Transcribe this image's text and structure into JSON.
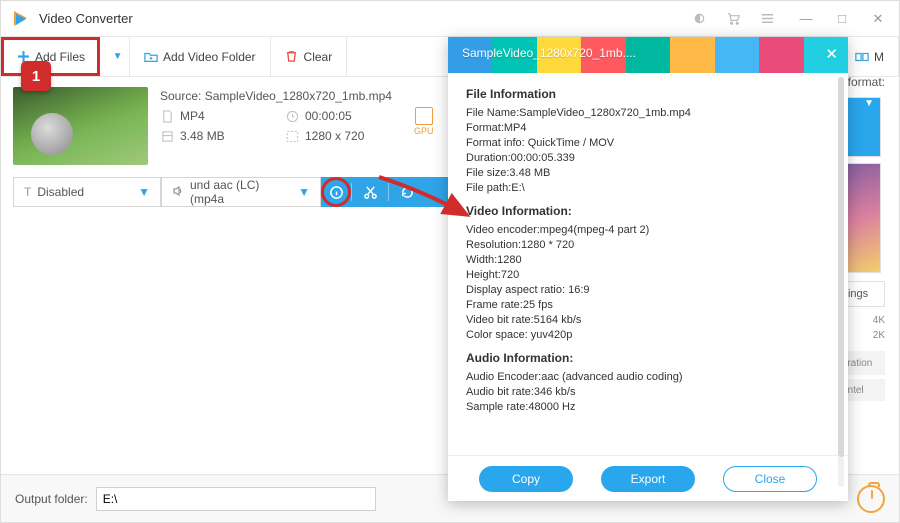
{
  "app": {
    "title": "Video Converter"
  },
  "toolbar": {
    "addFiles": "Add Files",
    "addFolder": "Add Video Folder",
    "clear": "Clear",
    "merge": "M"
  },
  "file": {
    "source": "Source: SampleVideo_1280x720_1mb.mp4",
    "format": "MP4",
    "duration": "00:00:05",
    "size": "3.48 MB",
    "resolution": "1280 x 720",
    "gpu": "GPU"
  },
  "actions": {
    "disabled": "Disabled",
    "audio": "und aac (LC) (mp4a"
  },
  "annotation": {
    "step": "1"
  },
  "sidebar": {
    "label": "ut format:",
    "settings": "ttings",
    "q4k": "4K",
    "q2k": "2K",
    "accel": "celeration",
    "intel": "Intel"
  },
  "output": {
    "label": "Output folder:",
    "path": "E:\\"
  },
  "popup": {
    "title": "SampleVideo_1280x720_1mb....",
    "sectFile": "File Information",
    "fileName": "File Name:SampleVideo_1280x720_1mb.mp4",
    "format": "Format:MP4",
    "formatInfo": "Format info: QuickTime / MOV",
    "duration": "Duration:00:00:05.339",
    "filesize": "File size:3.48 MB",
    "filepath": "File path:E:\\",
    "sectVideo": "Video Information:",
    "vEncoder": "Video encoder:mpeg4(mpeg-4 part 2)",
    "vRes": "Resolution:1280 * 720",
    "vWidth": "Width:1280",
    "vHeight": "Height:720",
    "vDar": "Display aspect ratio: 16:9",
    "vFps": "Frame rate:25 fps",
    "vBitrate": "Video bit rate:5164 kb/s",
    "vColor": "Color space: yuv420p",
    "sectAudio": "Audio Information:",
    "aEncoder": "Audio Encoder:aac (advanced audio coding)",
    "aBitrate": "Audio bit rate:346 kb/s",
    "aSample": "Sample rate:48000 Hz",
    "copy": "Copy",
    "export": "Export",
    "close": "Close"
  }
}
